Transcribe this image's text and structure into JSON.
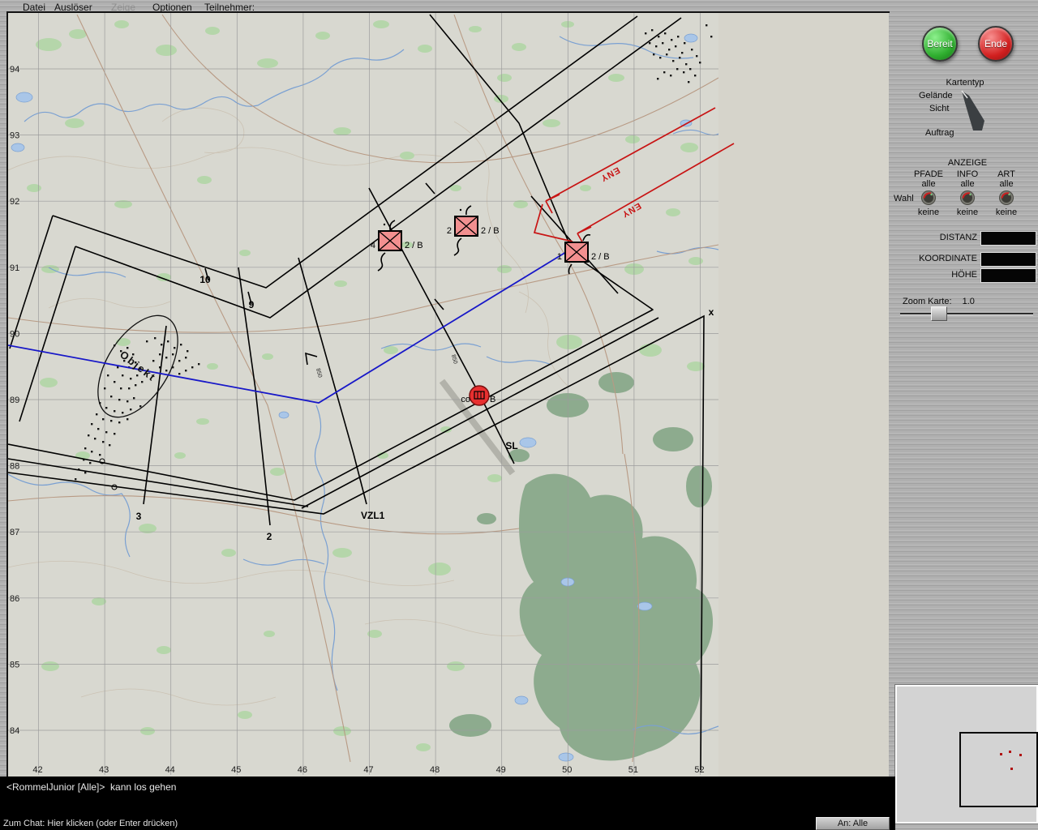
{
  "menu": {
    "items": [
      {
        "label": "Datei",
        "enabled": true
      },
      {
        "label": "Auslöser",
        "enabled": true
      },
      {
        "label": "Zeige",
        "enabled": false
      },
      {
        "label": "Optionen",
        "enabled": true
      },
      {
        "label": "Teilnehmer:",
        "enabled": true
      }
    ]
  },
  "sidebar": {
    "ready": "Bereit",
    "end": "Ende",
    "kartentyp": "Kartentyp",
    "gelaende": "Gelände",
    "sicht": "Sicht",
    "auftrag": "Auftrag",
    "anzeige": {
      "title": "ANZEIGE",
      "wahl": "Wahl",
      "knobs": [
        {
          "name": "PFADE",
          "top": "alle",
          "bottom": "keine"
        },
        {
          "name": "INFO",
          "top": "alle",
          "bottom": "keine"
        },
        {
          "name": "ART",
          "top": "alle",
          "bottom": "keine"
        }
      ]
    },
    "readouts": {
      "distanz": "DISTANZ",
      "koordinate": "KOORDINATE",
      "hoehe": "HÖHE",
      "distanz_value": "",
      "koordinate_value": "",
      "hoehe_value": ""
    },
    "zoom": {
      "label": "Zoom Karte:",
      "value": "1.0"
    }
  },
  "map": {
    "grid_x": [
      "42",
      "43",
      "44",
      "45",
      "46",
      "47",
      "48",
      "49",
      "50",
      "51",
      "52"
    ],
    "grid_y": [
      "94",
      "93",
      "92",
      "91",
      "90",
      "89",
      "88",
      "87",
      "86",
      "85",
      "84"
    ],
    "units": [
      {
        "id": "4",
        "name": "2 / B"
      },
      {
        "id": "2",
        "name": "2 / B"
      },
      {
        "id": "1",
        "name": "2 / B"
      }
    ],
    "hq": {
      "left": "co",
      "right": "B"
    },
    "labels": {
      "objekt": "Objekt",
      "sl": "SL",
      "vzl1": "VZL1",
      "n10": "10",
      "n9": "9",
      "n3": "3",
      "n2": "2",
      "eny": "ENY",
      "x_marker": "x",
      "spot": "850"
    }
  },
  "chat": {
    "message": "<RommelJunior [Alle]>  kann los gehen",
    "prompt": "Zum Chat: Hier klicken (oder Enter drücken)",
    "to": "An: Alle"
  },
  "colors": {
    "map_bg": "#d8d8d0",
    "forest_light": "#b5d6aa",
    "forest_dark": "#8dab8e",
    "water": "#7aa0d2",
    "road": "#b89a84",
    "overlay_black": "#000000",
    "overlay_blue": "#1818c8",
    "overlay_red": "#c81414",
    "unit_fill": "#f29090",
    "ready_green": "#2fae2f",
    "end_red": "#cc1c1c"
  }
}
